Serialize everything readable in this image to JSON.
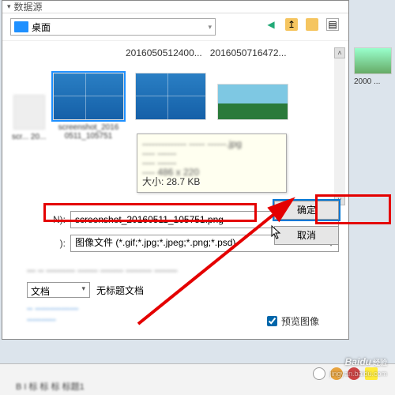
{
  "titlebar": {
    "label": "数据源"
  },
  "location": {
    "label": "桌面"
  },
  "file_header": {
    "a": "2016050512400...",
    "b": "2016050716472..."
  },
  "tooltip": {
    "size_label": "大小:",
    "size_value": "28.7 KB"
  },
  "form": {
    "filename_label": "N):",
    "filename_value": "screenshot_20160511_105751.png",
    "filetype_label": "):",
    "filetype_value": "图像文件 (*.gif;*.jpg;*.jpeg;*.png;*.psd)"
  },
  "buttons": {
    "ok": "确定",
    "cancel": "取消"
  },
  "lower": {
    "doc_select": "文档",
    "doc_untitled": "无标题文档"
  },
  "checkbox": {
    "label": "预览图像"
  },
  "preview": {
    "caption": "2000 ..."
  },
  "watermark": {
    "brand": "Baidu",
    "sub": "经验",
    "url": "jingyan.baidu.com"
  },
  "toolbar_bottom": "B   I   标  标  标   标题1"
}
